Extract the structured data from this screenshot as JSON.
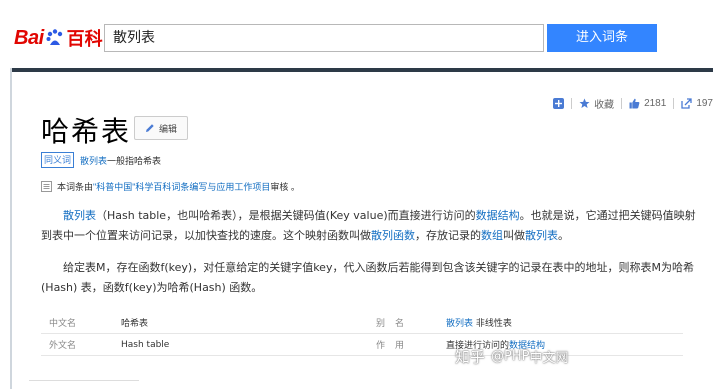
{
  "logo": {
    "bai": "Bai",
    "du": "du",
    "baike": "百科"
  },
  "search": {
    "value": "散列表",
    "button": "进入词条"
  },
  "actions": {
    "collect": "收藏",
    "likes": "2181",
    "shares": "197"
  },
  "title": "哈希表",
  "edit_label": "编辑",
  "synonym": {
    "tag": "同义词",
    "link": "散列表",
    "rest": "一般指哈希表"
  },
  "review": {
    "prefix": "本词条由",
    "link": "\"科普中国\"科学百科词条编写与应用工作项目",
    "suffix": " 审核 。"
  },
  "para1": {
    "l1": "散列表",
    "t1": "（Hash table，也叫哈希表），是根据关键码值(Key value)而直接进行访问的",
    "l2": "数据结构",
    "t2": "。也就是说，它通过把关键码值映射到表中一个位置来访问记录，以加快查找的速度。这个映射函数叫做",
    "l3": "散列函数",
    "t3": "，存放记录的",
    "l4": "数组",
    "t4": "叫做",
    "l5": "散列表",
    "t5": "。"
  },
  "para2": "给定表M，存在函数f(key)，对任意给定的关键字值key，代入函数后若能得到包含该关键字的记录在表中的地址，则称表M为哈希(Hash) 表，函数f(key)为哈希(Hash) 函数。",
  "info": {
    "rows": [
      {
        "k": "中文名",
        "v": "哈希表",
        "k2": "别名",
        "v2_link": "散列表",
        "v2_text": " 非线性表"
      },
      {
        "k": "外文名",
        "v": "Hash table",
        "k2": "作用",
        "v2_text": "直接进行访问的",
        "v2_link": "数据结构"
      }
    ]
  },
  "watermark": {
    "zhihu": "知乎",
    "text": "@PHP"
  },
  "watermark2": "中文网",
  "colors": {
    "accent": "#3385ff",
    "link": "#136ec2",
    "brand_red": "#e10602"
  }
}
